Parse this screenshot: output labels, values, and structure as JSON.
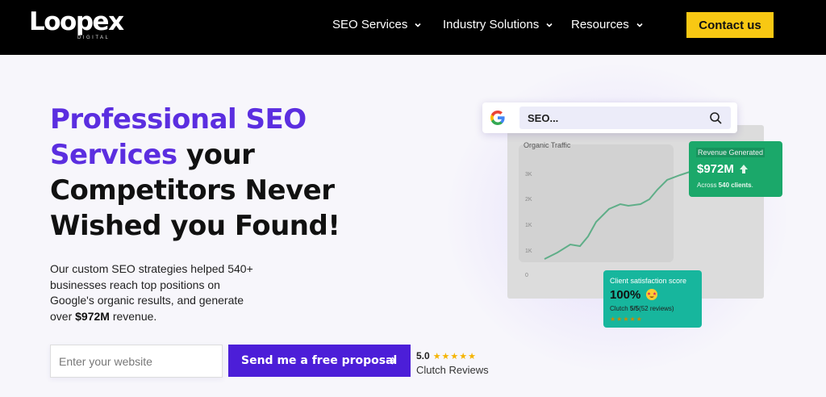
{
  "brand": {
    "name": "Loopex",
    "tagline": "DIGITAL"
  },
  "nav": {
    "items": [
      {
        "label": "SEO Services"
      },
      {
        "label": "Industry Solutions"
      },
      {
        "label": "Resources"
      }
    ],
    "contact_label": "Contact us",
    "contact_color": "#f8c813"
  },
  "hero": {
    "headline_accent": "Professional SEO Services",
    "headline_rest": " your Competitors Never Wished you Found!",
    "description_pre": "Our custom SEO strategies helped 540+ businesses reach top positions on Google's organic results, and generate over ",
    "description_bold": "$972M",
    "description_post": " revenue.",
    "input_placeholder": "Enter your website",
    "input_value": "",
    "cta_label": "Send me a free proposal",
    "accent_color": "#5b2ee0"
  },
  "rating": {
    "score": "5.0",
    "stars": "★★★★★",
    "source": "Clutch Reviews"
  },
  "visual": {
    "search_query": "SEO...",
    "traffic_label": "Organic Traffic",
    "ticks": [
      "3K",
      "2K",
      "1K",
      "1K",
      "0"
    ],
    "revenue_title": "Revenue Generated",
    "revenue_value": "$972M",
    "revenue_note_pre": "Across ",
    "revenue_note_bold": "540 clients",
    "revenue_note_post": ".",
    "csat_title": "Client satisfaction score",
    "csat_value": "100%",
    "csat_sub_pre": "Clutch ",
    "csat_sub_bold": "5/5",
    "csat_sub_post": "(52 reviews)",
    "csat_stars": "★★★★★"
  }
}
